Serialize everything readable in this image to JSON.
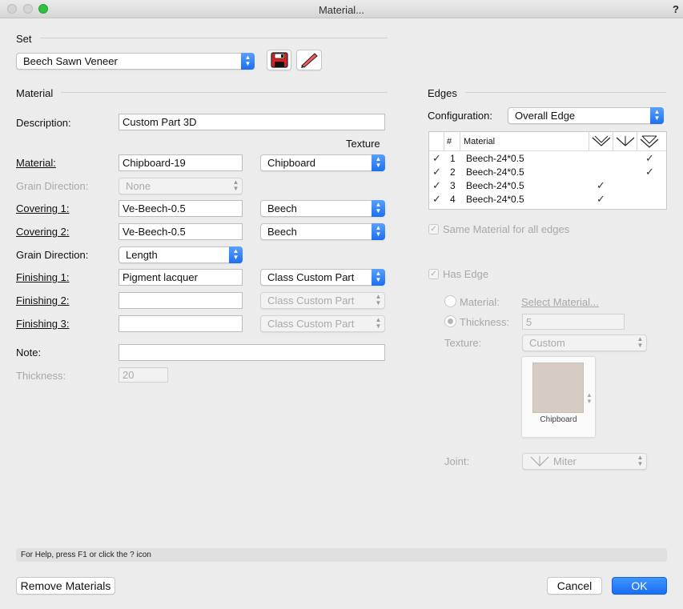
{
  "window": {
    "title": "Material...",
    "help_glyph": "?"
  },
  "set": {
    "section_label": "Set",
    "selected": "Beech Sawn Veneer"
  },
  "material_section": {
    "section_label": "Material",
    "description_label": "Description:",
    "description_value": "Custom Part 3D",
    "texture_header": "Texture",
    "material_label": "Material:",
    "material_value": "Chipboard-19",
    "material_texture": "Chipboard",
    "grain1_label": "Grain Direction:",
    "grain1_value": "None",
    "covering1_label": "Covering 1:",
    "covering1_value": "Ve-Beech-0.5",
    "covering1_texture": "Beech",
    "covering2_label": "Covering 2:",
    "covering2_value": "Ve-Beech-0.5",
    "covering2_texture": "Beech",
    "grain2_label": "Grain Direction:",
    "grain2_value": "Length",
    "finishing1_label": "Finishing 1:",
    "finishing1_value": "Pigment lacquer",
    "finishing1_class": "Class Custom Part",
    "finishing2_label": "Finishing 2:",
    "finishing2_value": "",
    "finishing2_class": "Class Custom Part",
    "finishing3_label": "Finishing 3:",
    "finishing3_value": "",
    "finishing3_class": "Class Custom Part",
    "note_label": "Note:",
    "note_value": "",
    "thickness_label": "Thickness:",
    "thickness_value": "20"
  },
  "edges": {
    "section_label": "Edges",
    "configuration_label": "Configuration:",
    "configuration_value": "Overall Edge",
    "table_headers": {
      "num": "#",
      "material": "Material"
    },
    "rows": [
      {
        "num": "1",
        "material": "Beech-24*0.5"
      },
      {
        "num": "2",
        "material": "Beech-24*0.5"
      },
      {
        "num": "3",
        "material": "Beech-24*0.5"
      },
      {
        "num": "4",
        "material": "Beech-24*0.5"
      }
    ],
    "same_material_label": "Same Material for all edges",
    "has_edge_label": "Has Edge",
    "material_radio_label": "Material:",
    "select_material_link": "Select Material...",
    "thickness_radio_label": "Thickness:",
    "thickness_value": "5",
    "texture_label": "Texture:",
    "texture_value": "Custom",
    "swatch_caption": "Chipboard",
    "joint_label": "Joint:",
    "joint_value": "Miter"
  },
  "status_text": "For Help, press F1 or click the ? icon",
  "buttons": {
    "remove": "Remove Materials",
    "cancel": "Cancel",
    "ok": "OK"
  },
  "colors": {
    "accent": "#1a6ef5",
    "close": "#d0d0d0",
    "minimize": "#d0d0d0",
    "zoom": "#2fc13f"
  }
}
